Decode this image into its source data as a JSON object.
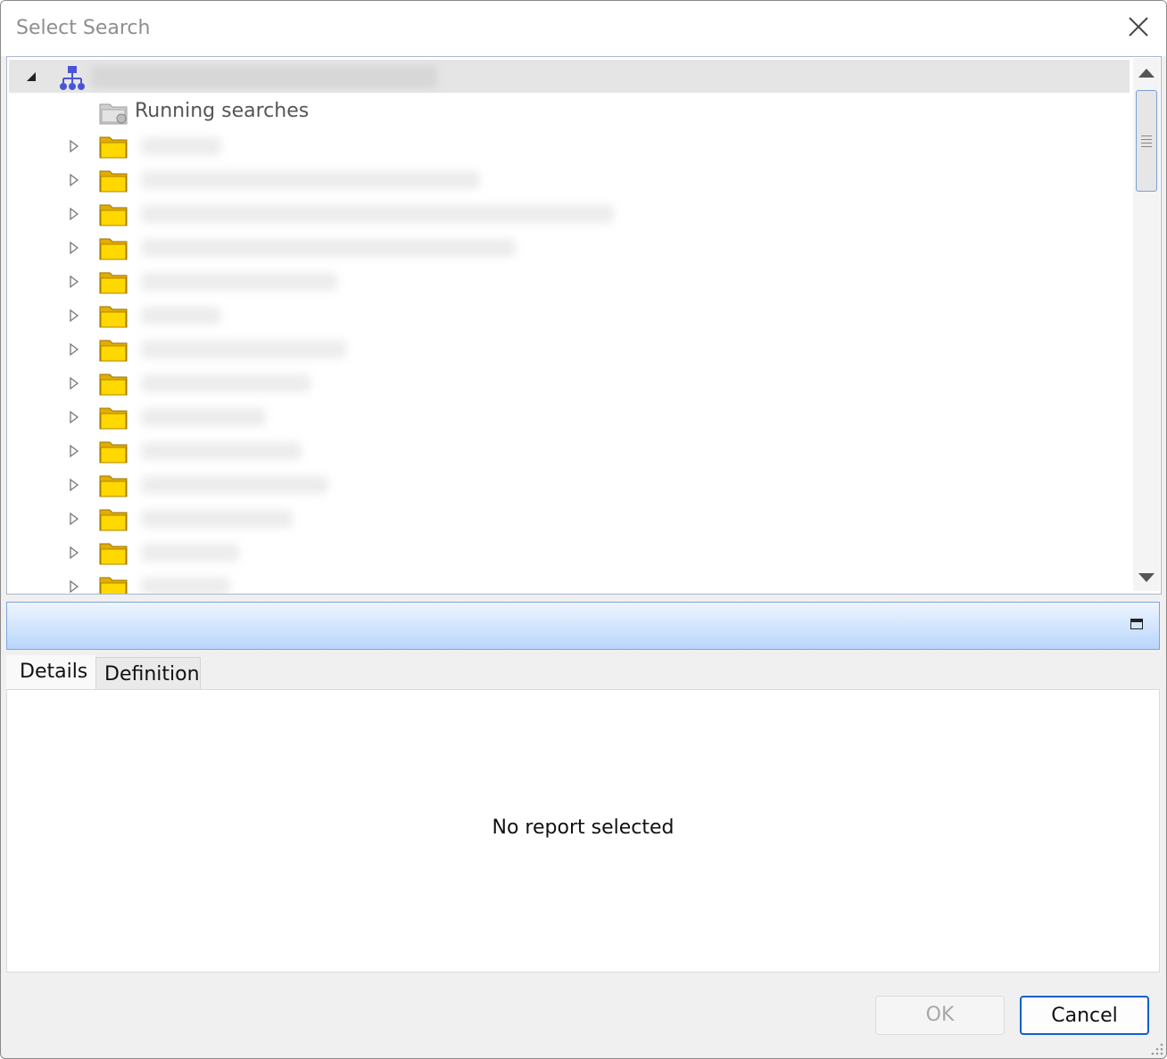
{
  "window": {
    "title": "Select Search"
  },
  "tree": {
    "root": {
      "icon": "network-hierarchy-icon",
      "label_redacted": true,
      "expanded": true
    },
    "items": [
      {
        "label": "Running searches",
        "icon": "running-searches-folder-icon"
      },
      {
        "icon": "folder-icon",
        "redacted": true
      },
      {
        "icon": "folder-icon",
        "redacted": true
      },
      {
        "icon": "folder-icon",
        "redacted": true
      },
      {
        "icon": "folder-icon",
        "redacted": true
      },
      {
        "icon": "folder-icon",
        "redacted": true
      },
      {
        "icon": "folder-icon",
        "redacted": true
      },
      {
        "icon": "folder-icon",
        "redacted": true
      },
      {
        "icon": "folder-icon",
        "redacted": true
      },
      {
        "icon": "folder-icon",
        "redacted": true
      },
      {
        "icon": "folder-icon",
        "redacted": true
      },
      {
        "icon": "folder-icon",
        "redacted": true
      },
      {
        "icon": "folder-icon",
        "redacted": true
      },
      {
        "icon": "folder-icon",
        "redacted": true
      },
      {
        "icon": "folder-icon",
        "redacted": true
      }
    ]
  },
  "tabs": [
    {
      "label": "Details",
      "selected": true
    },
    {
      "label": "Definition",
      "selected": false
    }
  ],
  "details": {
    "empty_message": "No report selected"
  },
  "buttons": {
    "ok": "OK",
    "ok_enabled": false,
    "cancel": "Cancel"
  },
  "colors": {
    "folder": "#ffd800",
    "accent": "#1060c8",
    "header_gradient_end": "#b8d6fb"
  }
}
